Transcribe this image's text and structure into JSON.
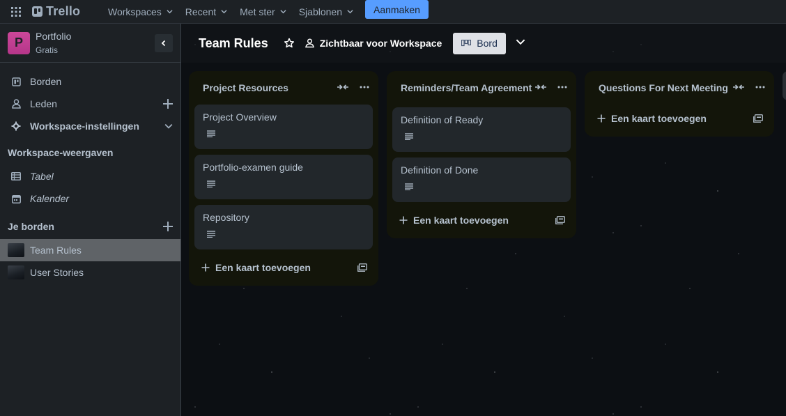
{
  "topnav": {
    "logo": "Trello",
    "menus": [
      "Workspaces",
      "Recent",
      "Met ster",
      "Sjablonen"
    ],
    "create_label": "Aanmaken"
  },
  "workspace": {
    "avatar_letter": "P",
    "name": "Portfolio",
    "plan": "Gratis",
    "avatar_color": "#c2408f"
  },
  "sidebar": {
    "items": [
      {
        "label": "Borden",
        "icon": "board-icon"
      },
      {
        "label": "Leden",
        "icon": "person-icon"
      },
      {
        "label": "Workspace-instellingen",
        "icon": "gear-icon"
      }
    ],
    "views_title": "Workspace-weergaven",
    "views": [
      {
        "label": "Tabel",
        "icon": "table-icon"
      },
      {
        "label": "Kalender",
        "icon": "calendar-icon"
      }
    ],
    "boards_title": "Je borden",
    "boards": [
      {
        "label": "Team Rules",
        "active": true
      },
      {
        "label": "User Stories",
        "active": false
      }
    ]
  },
  "board": {
    "title": "Team Rules",
    "visibility": "Zichtbaar voor Workspace",
    "view_label": "Bord",
    "lists": [
      {
        "title": "Project Resources",
        "cards": [
          "Project Overview",
          "Portfolio-examen guide",
          "Repository"
        ],
        "add_label": "Een kaart toevoegen"
      },
      {
        "title": "Reminders/Team Agreement",
        "cards": [
          "Definition of Ready",
          "Definition of Done"
        ],
        "add_label": "Een kaart toevoegen"
      },
      {
        "title": "Questions For Next Meeting",
        "cards": [],
        "add_label": "Een kaart toevoegen"
      }
    ]
  },
  "colors": {
    "accent": "#579dff",
    "topnav_bg": "#1d2125",
    "list_bg": "#13150a",
    "card_bg": "#22272b"
  }
}
